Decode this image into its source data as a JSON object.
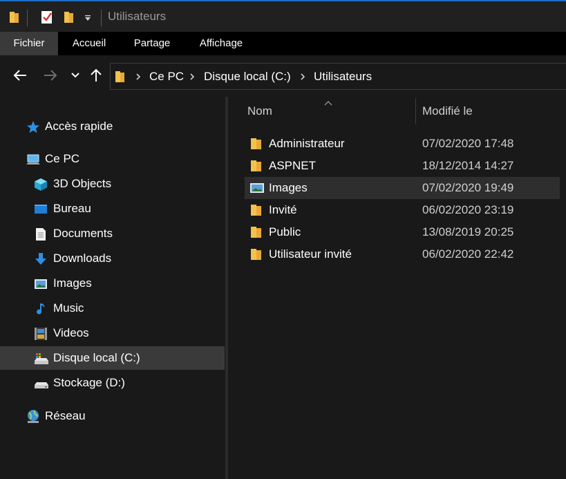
{
  "window": {
    "title": "Utilisateurs",
    "accent": "#1f6fc7"
  },
  "quick_access": {
    "items": [
      "folder-icon",
      "properties-check-icon",
      "new-folder-icon",
      "customize-dropdown-icon"
    ]
  },
  "ribbon": {
    "tabs": [
      {
        "label": "Fichier",
        "active": true
      },
      {
        "label": "Accueil",
        "active": false
      },
      {
        "label": "Partage",
        "active": false
      },
      {
        "label": "Affichage",
        "active": false
      }
    ]
  },
  "address": {
    "crumbs": [
      "Ce PC",
      "Disque local (C:)",
      "Utilisateurs"
    ]
  },
  "sidebar": {
    "quick_access": "Accès rapide",
    "this_pc": "Ce PC",
    "items": [
      {
        "label": "3D Objects",
        "icon": "3d-objects-icon"
      },
      {
        "label": "Bureau",
        "icon": "desktop-icon"
      },
      {
        "label": "Documents",
        "icon": "documents-icon"
      },
      {
        "label": "Downloads",
        "icon": "downloads-icon"
      },
      {
        "label": "Images",
        "icon": "pictures-icon"
      },
      {
        "label": "Music",
        "icon": "music-icon"
      },
      {
        "label": "Videos",
        "icon": "videos-icon"
      },
      {
        "label": "Disque local (C:)",
        "icon": "local-disk-icon",
        "selected": true
      },
      {
        "label": "Stockage (D:)",
        "icon": "drive-icon"
      }
    ],
    "network": "Réseau"
  },
  "columns": {
    "name": "Nom",
    "modified": "Modifié le"
  },
  "files": [
    {
      "name": "Administrateur",
      "date": "07/02/2020 17:48",
      "icon": "folder-icon"
    },
    {
      "name": "ASPNET",
      "date": "18/12/2014 14:27",
      "icon": "folder-icon"
    },
    {
      "name": "Images",
      "date": "07/02/2020 19:49",
      "icon": "pictures-folder-icon",
      "hover": true
    },
    {
      "name": "Invité",
      "date": "06/02/2020 23:19",
      "icon": "folder-icon"
    },
    {
      "name": "Public",
      "date": "13/08/2019 20:25",
      "icon": "folder-icon"
    },
    {
      "name": "Utilisateur invité",
      "date": "06/02/2020 22:42",
      "icon": "folder-icon"
    }
  ]
}
